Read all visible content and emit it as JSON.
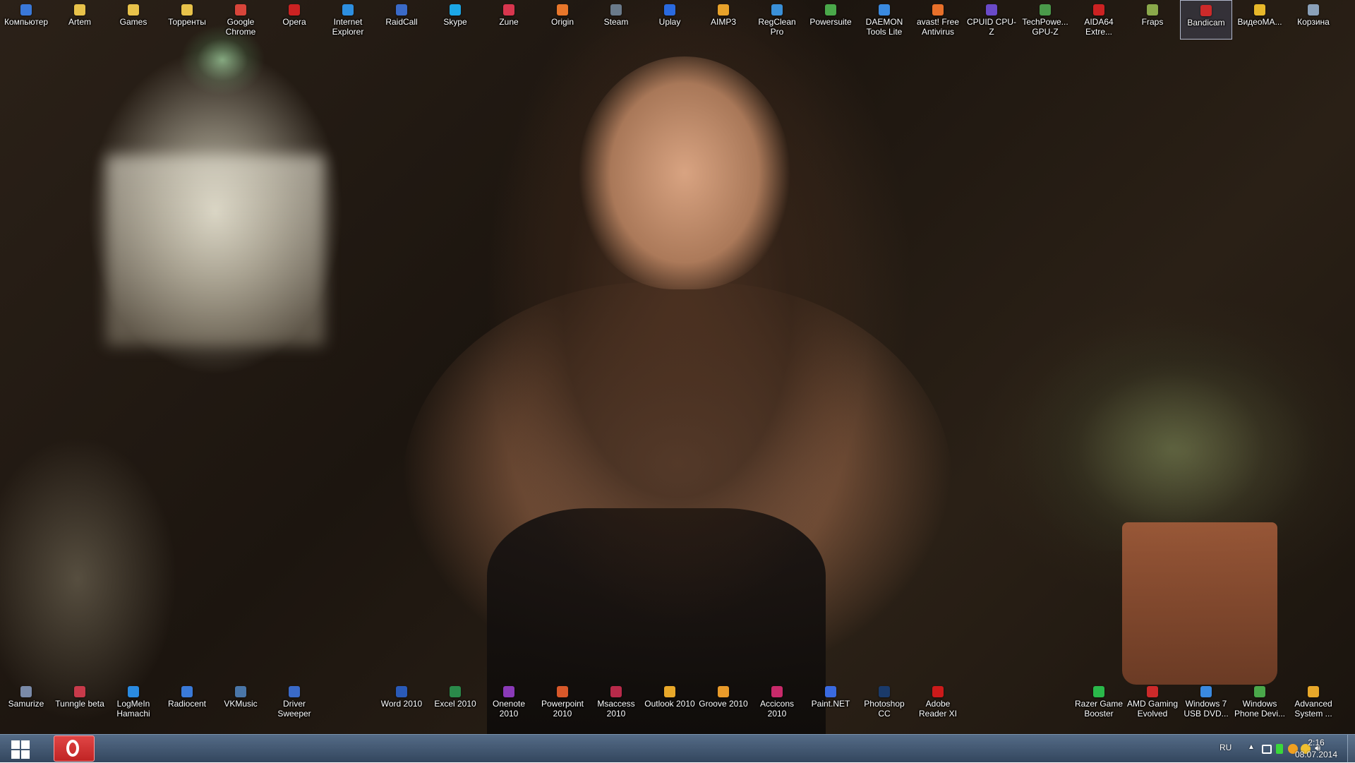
{
  "desktop": {
    "top_icons": [
      {
        "label": "Компьютер",
        "icon": "computer-icon",
        "color": "#3a78d8"
      },
      {
        "label": "Artem",
        "icon": "folder-icon",
        "color": "#e8c24a"
      },
      {
        "label": "Games",
        "icon": "folder-icon",
        "color": "#e8c24a"
      },
      {
        "label": "Торренты",
        "icon": "folder-icon",
        "color": "#e8c24a"
      },
      {
        "label": "Google Chrome",
        "icon": "chrome-icon",
        "color": "#d8453a"
      },
      {
        "label": "Opera",
        "icon": "opera-icon",
        "color": "#cc2222"
      },
      {
        "label": "Internet Explorer",
        "icon": "ie-icon",
        "color": "#2d8fe0"
      },
      {
        "label": "RaidCall",
        "icon": "raidcall-icon",
        "color": "#3a6ac8"
      },
      {
        "label": "Skype",
        "icon": "skype-icon",
        "color": "#1ca7e6"
      },
      {
        "label": "Zune",
        "icon": "zune-icon",
        "color": "#d8364e"
      },
      {
        "label": "Origin",
        "icon": "origin-icon",
        "color": "#e8762a"
      },
      {
        "label": "Steam",
        "icon": "steam-icon",
        "color": "#6a7a8a"
      },
      {
        "label": "Uplay",
        "icon": "uplay-icon",
        "color": "#2a6ae0"
      },
      {
        "label": "AIMP3",
        "icon": "aimp-icon",
        "color": "#e8a22a"
      },
      {
        "label": "RegClean Pro",
        "icon": "regclean-icon",
        "color": "#3a90d8"
      },
      {
        "label": "Powersuite",
        "icon": "powersuite-icon",
        "color": "#4aa84a"
      },
      {
        "label": "DAEMON Tools Lite",
        "icon": "daemon-tools-icon",
        "color": "#3a8ae0"
      },
      {
        "label": "avast! Free Antivirus",
        "icon": "avast-icon",
        "color": "#e8702a"
      },
      {
        "label": "CPUID CPU-Z",
        "icon": "cpuz-icon",
        "color": "#6a4ac8"
      },
      {
        "label": "TechPowe... GPU-Z",
        "icon": "gpuz-icon",
        "color": "#4a9a4a"
      },
      {
        "label": "AIDA64 Extre...",
        "icon": "aida64-icon",
        "color": "#cc2222"
      },
      {
        "label": "Fraps",
        "icon": "fraps-icon",
        "color": "#8aa84a"
      },
      {
        "label": "Bandicam",
        "icon": "bandicam-icon",
        "color": "#cc2a2a",
        "selected": true
      },
      {
        "label": "ВидеоМА...",
        "icon": "videomaster-icon",
        "color": "#e8b82a"
      },
      {
        "label": "Корзина",
        "icon": "recycle-bin-icon",
        "color": "#8aa0b8"
      }
    ],
    "bottom_left_icons": [
      {
        "label": "Samurize",
        "icon": "samurize-icon",
        "color": "#7a8aa8"
      },
      {
        "label": "Tunngle beta",
        "icon": "tunngle-icon",
        "color": "#c83a4a"
      },
      {
        "label": "LogMeIn Hamachi",
        "icon": "hamachi-icon",
        "color": "#2a8ae0"
      },
      {
        "label": "Radiocent",
        "icon": "radiocent-icon",
        "color": "#3a7ad8"
      },
      {
        "label": "VKMusic",
        "icon": "vkmusic-icon",
        "color": "#4a76a8"
      },
      {
        "label": "Driver Sweeper",
        "icon": "driver-sweeper-icon",
        "color": "#3a6ac8"
      }
    ],
    "bottom_center_icons": [
      {
        "label": "Word 2010",
        "icon": "word-icon",
        "color": "#2a5ab8"
      },
      {
        "label": "Excel 2010",
        "icon": "excel-icon",
        "color": "#2a8a4a"
      },
      {
        "label": "Onenote 2010",
        "icon": "onenote-icon",
        "color": "#8a3ab8"
      },
      {
        "label": "Powerpoint 2010",
        "icon": "powerpoint-icon",
        "color": "#d8582a"
      },
      {
        "label": "Msaccess 2010",
        "icon": "access-icon",
        "color": "#b82a4a"
      },
      {
        "label": "Outlook 2010",
        "icon": "outlook-icon",
        "color": "#e8a82a"
      },
      {
        "label": "Groove 2010",
        "icon": "groove-icon",
        "color": "#e89a2a"
      },
      {
        "label": "Accicons 2010",
        "icon": "accicons-icon",
        "color": "#c82a6a"
      },
      {
        "label": "Paint.NET",
        "icon": "paintnet-icon",
        "color": "#3a6ae0"
      },
      {
        "label": "Photoshop CC",
        "icon": "photoshop-icon",
        "color": "#1a3a6a"
      },
      {
        "label": "Adobe Reader XI",
        "icon": "adobe-reader-icon",
        "color": "#cc1a1a"
      }
    ],
    "bottom_right_icons": [
      {
        "label": "Razer Game Booster",
        "icon": "razer-icon",
        "color": "#2ab84a"
      },
      {
        "label": "AMD Gaming Evolved",
        "icon": "amd-icon",
        "color": "#cc2a2a"
      },
      {
        "label": "Windows 7 USB DVD...",
        "icon": "usb-dvd-tool-icon",
        "color": "#3a8ae0"
      },
      {
        "label": "Windows Phone Devi...",
        "icon": "windows-phone-icon",
        "color": "#4aa84a"
      },
      {
        "label": "Advanced System ...",
        "icon": "advanced-systemcare-icon",
        "color": "#e8a82a"
      }
    ]
  },
  "taskbar": {
    "pinned": [
      {
        "label": "Opera",
        "icon": "opera-icon",
        "color": "#cc2222"
      }
    ],
    "tray": {
      "language": "RU",
      "time": "2:16",
      "date": "08.07.2014",
      "icons": [
        {
          "icon": "network-icon",
          "color": "#ffffff"
        },
        {
          "icon": "download-arrow-icon",
          "color": "#3ad83a"
        },
        {
          "icon": "avast-tray-icon",
          "color": "#f0a020"
        },
        {
          "icon": "aimp-tray-icon",
          "color": "#f0c030"
        },
        {
          "icon": "volume-icon",
          "color": "#ffffff"
        }
      ]
    }
  }
}
